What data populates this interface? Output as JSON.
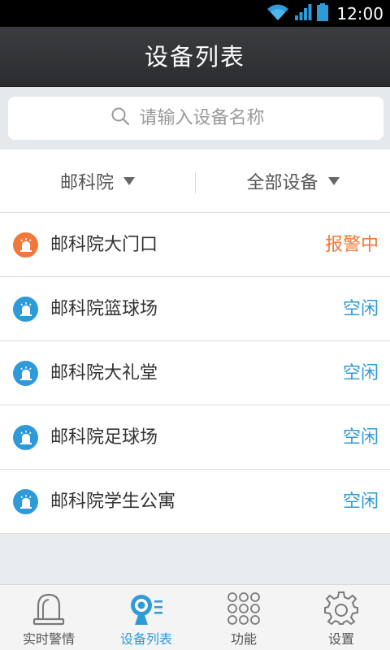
{
  "status_bar": {
    "time": "12:00"
  },
  "header": {
    "title": "设备列表"
  },
  "search": {
    "placeholder": "请输入设备名称"
  },
  "filters": {
    "location": "邮科院",
    "type": "全部设备"
  },
  "devices": [
    {
      "name": "邮科院大门口",
      "status": "报警中",
      "state": "alarm"
    },
    {
      "name": "邮科院篮球场",
      "status": "空闲",
      "state": "idle"
    },
    {
      "name": "邮科院大礼堂",
      "status": "空闲",
      "state": "idle"
    },
    {
      "name": "邮科院足球场",
      "status": "空闲",
      "state": "idle"
    },
    {
      "name": "邮科院学生公寓",
      "status": "空闲",
      "state": "idle"
    }
  ],
  "tabs": [
    {
      "label": "实时警情",
      "icon": "alarm-light-icon",
      "active": false
    },
    {
      "label": "设备列表",
      "icon": "device-list-icon",
      "active": true
    },
    {
      "label": "功能",
      "icon": "grid-icon",
      "active": false
    },
    {
      "label": "设置",
      "icon": "gear-icon",
      "active": false
    }
  ],
  "colors": {
    "accent": "#2f9ad8",
    "alarm": "#f0783a",
    "header": "#2f3134"
  }
}
